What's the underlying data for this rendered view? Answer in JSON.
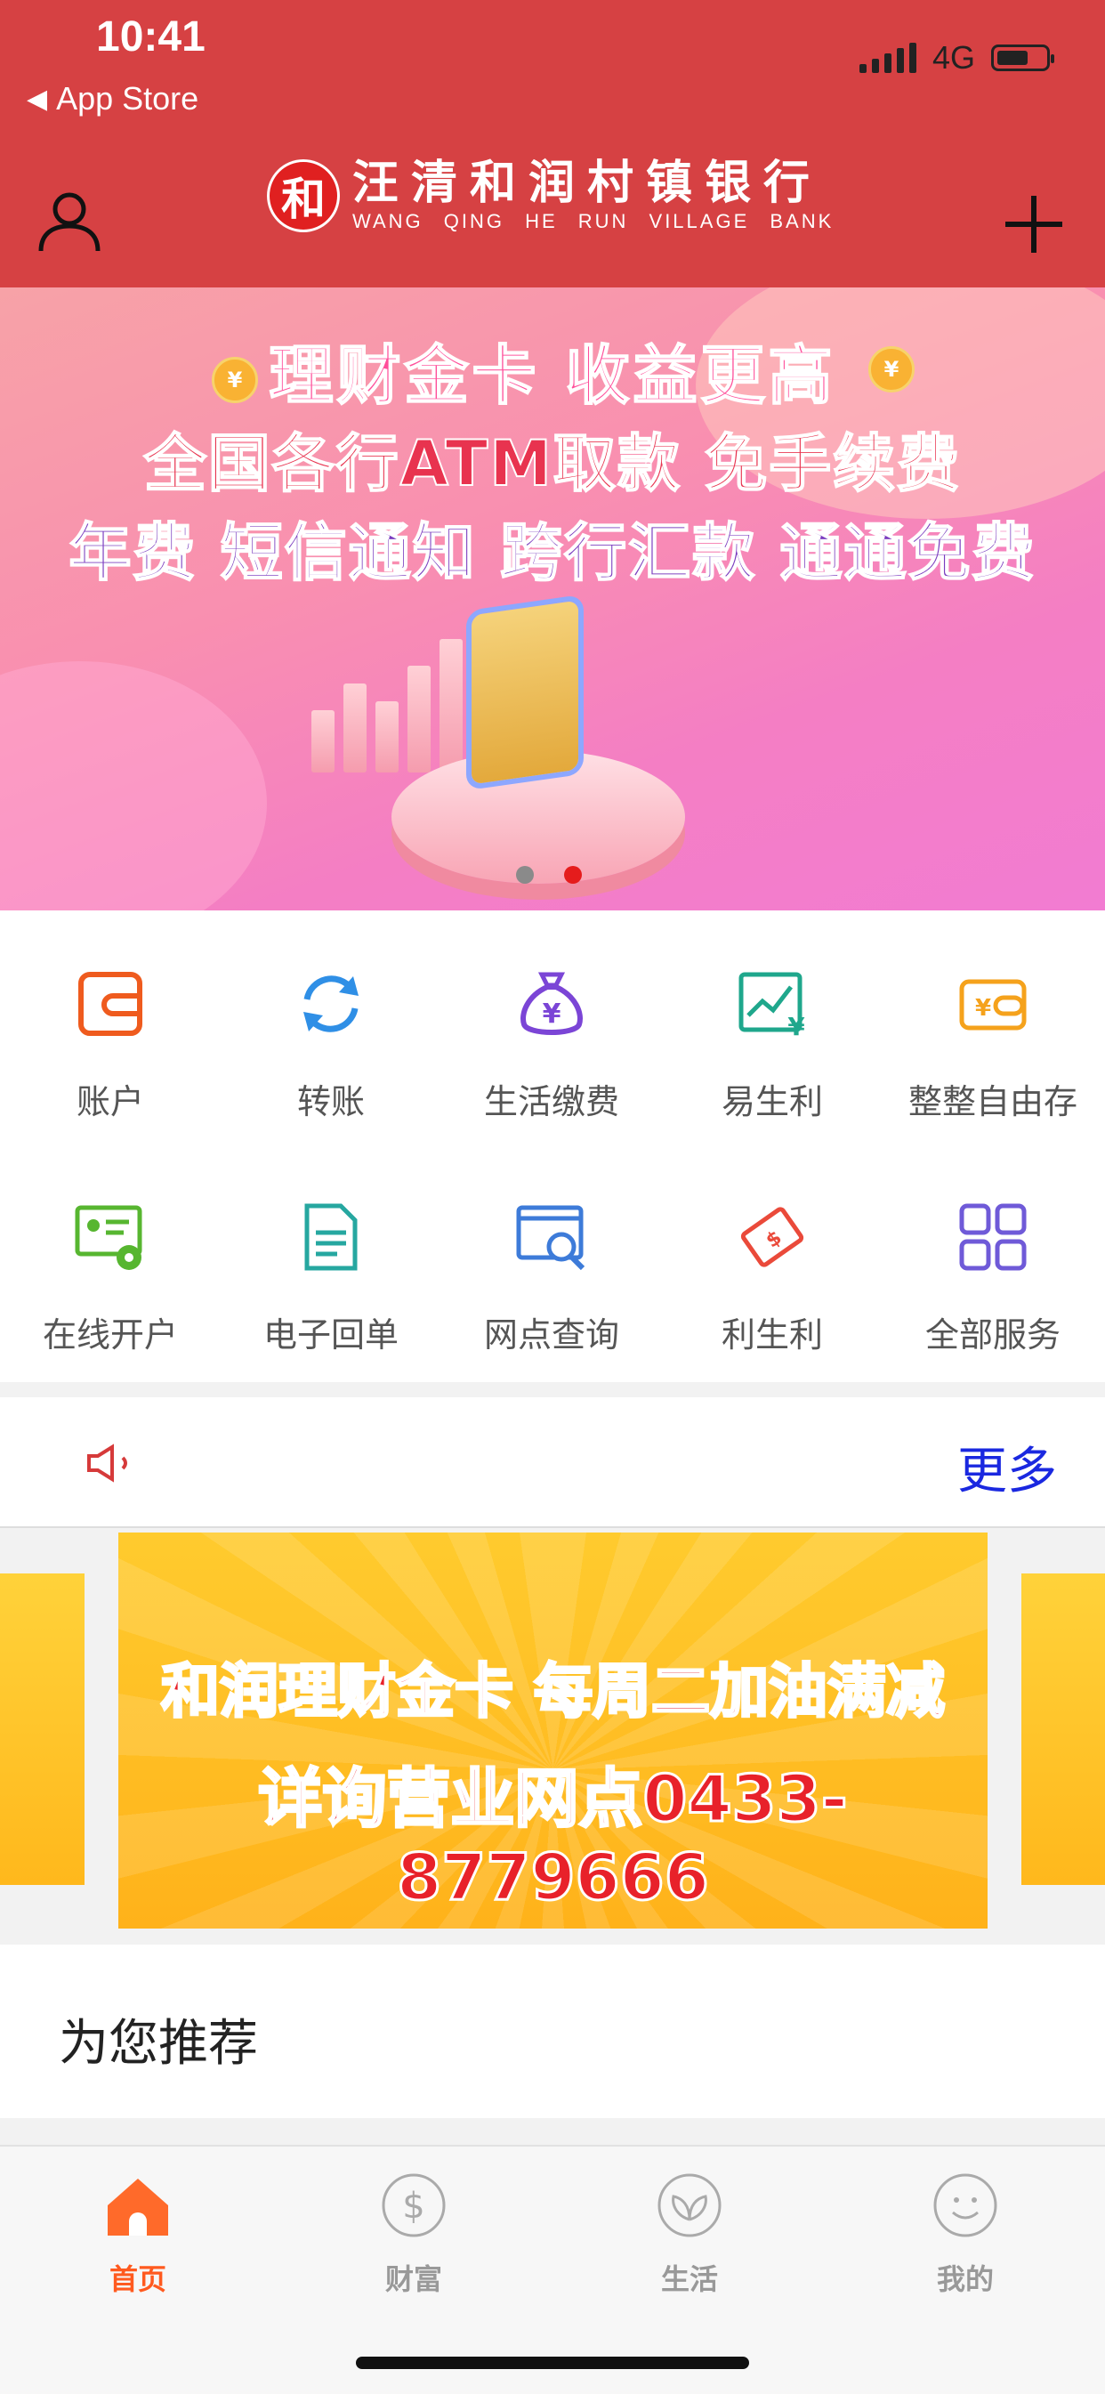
{
  "status_bar": {
    "time": "10:41",
    "back_app": "App Store",
    "network": "4G"
  },
  "header": {
    "bank_name_cn": "汪清和润村镇银行",
    "bank_name_en": "WANG QING HE RUN VILLAGE BANK",
    "logo_char": "和"
  },
  "banner": {
    "line1": "理财金卡 收益更高",
    "line2": "全国各行ATM取款 免手续费",
    "line3": "年费 短信通知 跨行汇款 通通免费",
    "coin_symbol": "¥",
    "pagination": {
      "count": 2,
      "active": 2
    }
  },
  "services": [
    {
      "label": "账户",
      "icon": "wallet-icon",
      "color": "#ef5b1e"
    },
    {
      "label": "转账",
      "icon": "transfer-refresh-icon",
      "color": "#2f8fe6"
    },
    {
      "label": "生活缴费",
      "icon": "money-bag-icon",
      "color": "#7b45d6"
    },
    {
      "label": "易生利",
      "icon": "chart-growth-icon",
      "color": "#1fa78c"
    },
    {
      "label": "整整自由存",
      "icon": "deposit-card-icon",
      "color": "#f5a21c"
    },
    {
      "label": "在线开户",
      "icon": "account-certificate-icon",
      "color": "#57b630"
    },
    {
      "label": "电子回单",
      "icon": "document-icon",
      "color": "#26a7a0"
    },
    {
      "label": "网点查询",
      "icon": "branch-search-icon",
      "color": "#3d7bd9"
    },
    {
      "label": "利生利",
      "icon": "money-note-icon",
      "color": "#ea4a3a"
    },
    {
      "label": "全部服务",
      "icon": "all-services-grid-icon",
      "color": "#6f5ad8"
    }
  ],
  "notice": {
    "more_label": "更多"
  },
  "promo": {
    "line1": "和润理财金卡 每周二加油满减",
    "line2": "详询营业网点0433-8779666"
  },
  "recommend": {
    "title": "为您推荐"
  },
  "tabbar": [
    {
      "label": "首页",
      "icon": "home-icon",
      "active": true
    },
    {
      "label": "财富",
      "icon": "dollar-coin-icon",
      "active": false
    },
    {
      "label": "生活",
      "icon": "leaf-icon",
      "active": false
    },
    {
      "label": "我的",
      "icon": "smiley-icon",
      "active": false
    }
  ],
  "colors": {
    "header_bg": "#d64143",
    "accent_active": "#ff5a1f",
    "more_link": "#1a28e0"
  }
}
